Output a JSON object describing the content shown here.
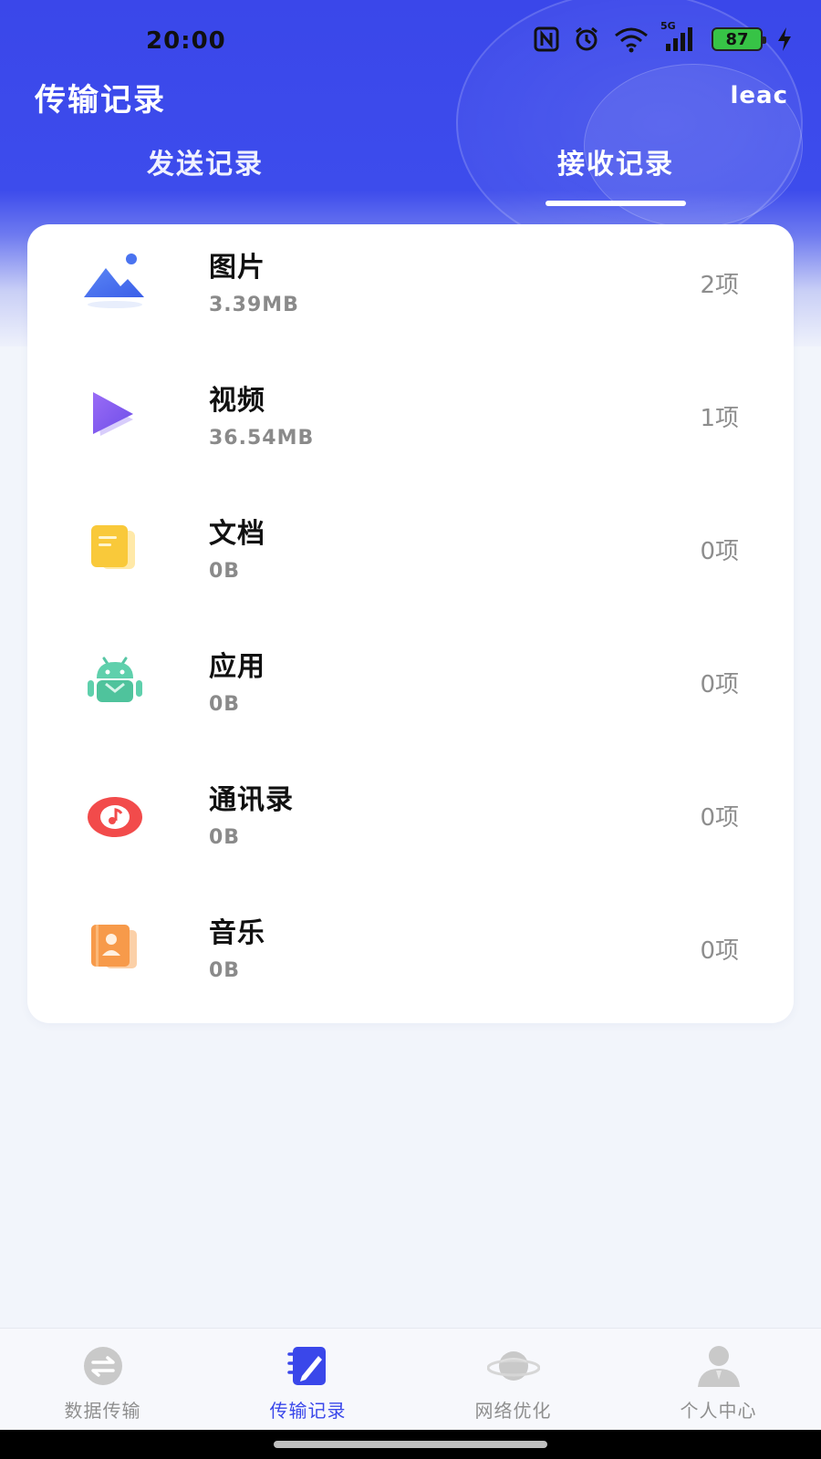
{
  "status_bar": {
    "time": "20:00",
    "network": "5G",
    "battery": "87",
    "icons": [
      "nfc-icon",
      "alarm-icon",
      "wifi-icon",
      "signal-icon",
      "battery-icon",
      "charging-icon"
    ]
  },
  "header": {
    "title": "传输记录",
    "right_text": "leac"
  },
  "tabs": [
    {
      "label": "发送记录",
      "active": false
    },
    {
      "label": "接收记录",
      "active": true
    }
  ],
  "records": [
    {
      "name": "图片",
      "size": "3.39MB",
      "count": "2项",
      "icon": "image-icon"
    },
    {
      "name": "视频",
      "size": "36.54MB",
      "count": "1项",
      "icon": "video-icon"
    },
    {
      "name": "文档",
      "size": "0B",
      "count": "0项",
      "icon": "document-icon"
    },
    {
      "name": "应用",
      "size": "0B",
      "count": "0项",
      "icon": "android-app-icon"
    },
    {
      "name": "通讯录",
      "size": "0B",
      "count": "0项",
      "icon": "music-note-icon"
    },
    {
      "name": "音乐",
      "size": "0B",
      "count": "0项",
      "icon": "contact-book-icon"
    }
  ],
  "bottom_nav": [
    {
      "label": "数据传输",
      "icon": "transfer-icon",
      "active": false
    },
    {
      "label": "传输记录",
      "icon": "record-notebook-icon",
      "active": true
    },
    {
      "label": "网络优化",
      "icon": "planet-icon",
      "active": false
    },
    {
      "label": "个人中心",
      "icon": "person-icon",
      "active": false
    }
  ],
  "colors": {
    "accent": "#3a47ea",
    "background": "#f2f5fb",
    "card": "#ffffff",
    "muted_text": "#8d8d8d"
  }
}
